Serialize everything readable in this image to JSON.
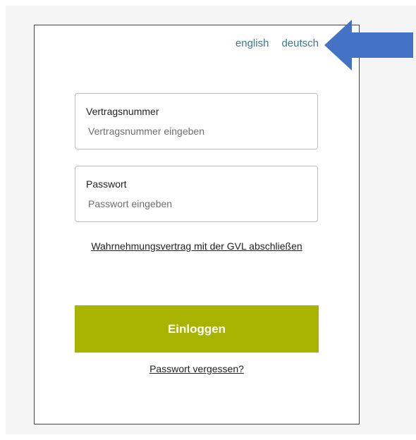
{
  "language_switch": {
    "english_label": "english",
    "deutsch_label": "deutsch"
  },
  "contract_field": {
    "label": "Vertragsnummer",
    "placeholder": "Vertragsnummer eingeben",
    "value": ""
  },
  "password_field": {
    "label": "Passwort",
    "placeholder": "Passwort eingeben",
    "value": ""
  },
  "links": {
    "contract_label": "Wahrnehmungsvertrag mit der GVL abschließen",
    "forgot_password_label": "Passwort vergessen?"
  },
  "login_button": {
    "label": "Einloggen"
  },
  "colors": {
    "accent_button": "#a8b400",
    "language_link": "#3a7a8e",
    "annotation_arrow": "#4472c4"
  },
  "annotation": {
    "icon": "left-arrow-icon"
  }
}
